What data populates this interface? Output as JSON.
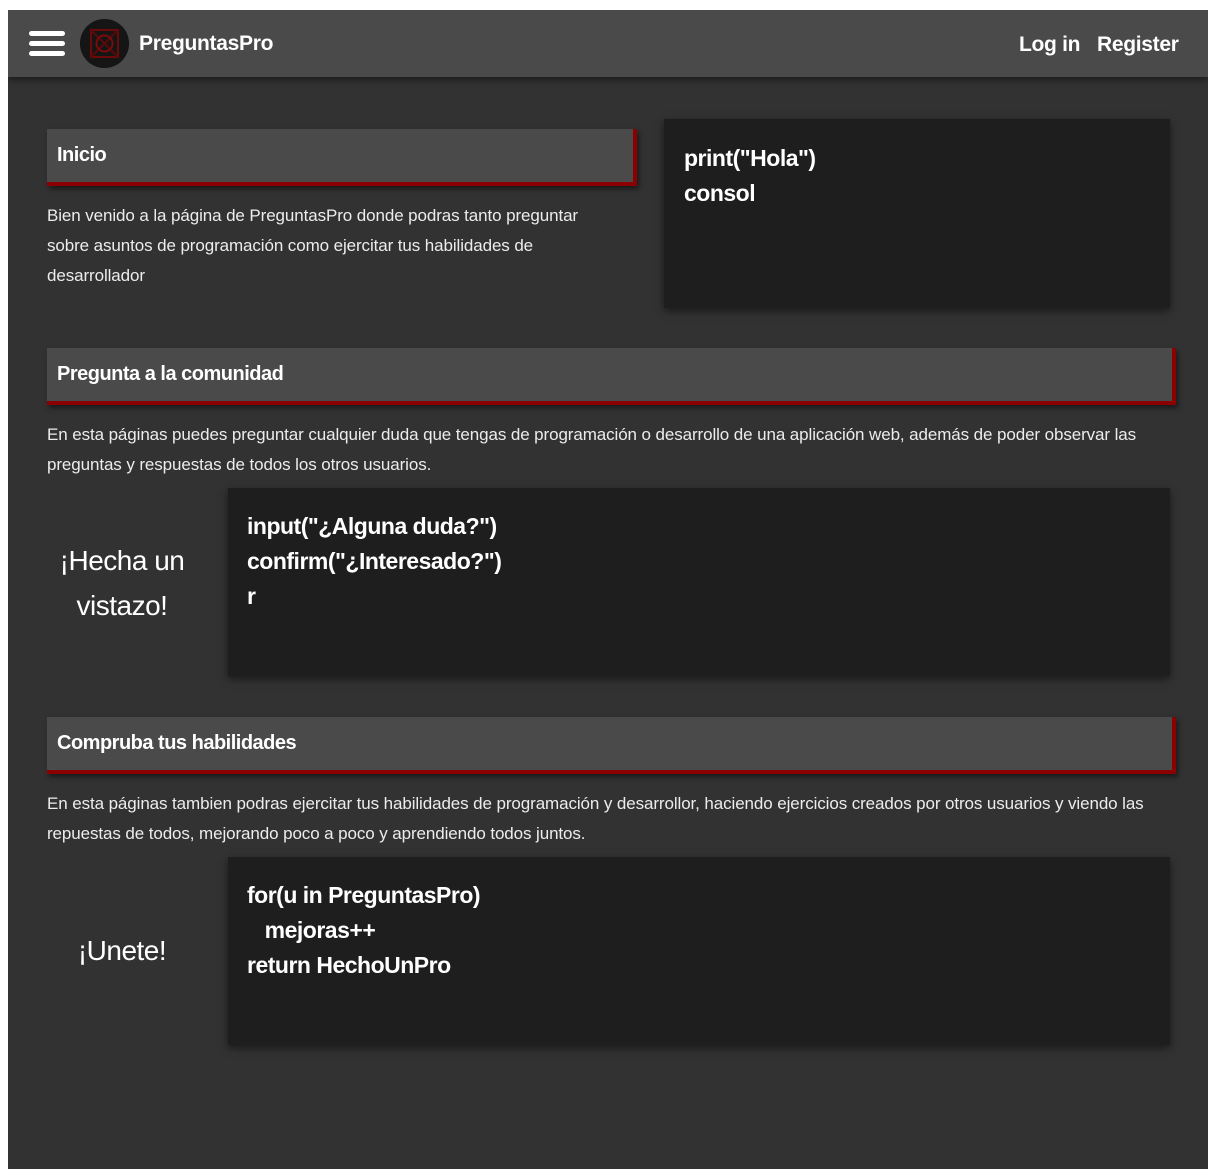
{
  "app": {
    "brand": "PreguntasPro",
    "nav": {
      "login": "Log in",
      "register": "Register"
    }
  },
  "icons": {
    "menu": "hamburger-menu-icon",
    "logo": "site-logo"
  },
  "colors": {
    "background": "#323232",
    "topbar": "#4a4a4a",
    "header": "#4a4a4a",
    "accent": "#8b0000",
    "code_bg": "#1e1e1e",
    "text": "#ffffff"
  },
  "inicio": {
    "title": "Inicio",
    "text": "Bien venido a la página de PreguntasPro donde podras tanto preguntar sobre asuntos de programación como ejercitar tus habilidades de desarrollador",
    "code": [
      "print(\"Hola\")",
      "consol"
    ]
  },
  "comunidad": {
    "title": "Pregunta a la comunidad",
    "text": "En esta páginas puedes preguntar cualquier duda que tengas de programación o desarrollo de una aplicación web, además de poder observar las preguntas y respuestas de todos los otros usuarios.",
    "tagline_1": "¡Hecha un",
    "tagline_2": "vistazo!",
    "code": [
      "input(\"¿Alguna duda?\")",
      "confirm(\"¿Interesado?\")",
      "r"
    ]
  },
  "habilidades": {
    "title": "Compruba tus habilidades",
    "text": "En esta páginas tambien podras ejercitar tus habilidades de programación y desarrollor, haciendo ejercicios creados por otros usuarios y viendo las repuestas de todos, mejorando poco a poco y aprendiendo todos juntos.",
    "tagline": "¡Unete!",
    "code": [
      "for(u in PreguntasPro)",
      "   mejoras++",
      "return HechoUnPro"
    ]
  }
}
